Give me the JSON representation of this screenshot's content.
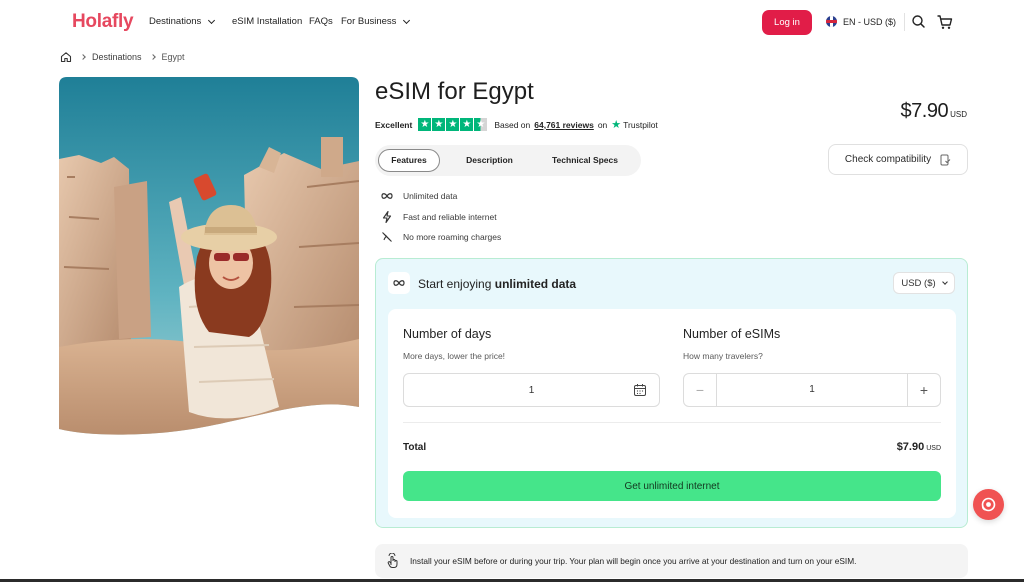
{
  "header": {
    "logo": "Holafly",
    "nav": [
      {
        "label": "Destinations",
        "has_dropdown": true
      },
      {
        "label": "eSIM Installation",
        "has_dropdown": false
      },
      {
        "label": "FAQs",
        "has_dropdown": false
      },
      {
        "label": "For Business",
        "has_dropdown": true
      }
    ],
    "login_label": "Log in",
    "language": "EN - USD ($)",
    "icons": [
      "globe-flag-icon",
      "search-icon",
      "cart-icon"
    ]
  },
  "breadcrumb": {
    "home_icon": "home-icon",
    "items": [
      "Destinations",
      "Egypt"
    ]
  },
  "product": {
    "title": "eSIM for Egypt",
    "price": "$7.90",
    "price_currency": "USD",
    "rating": {
      "label": "Excellent",
      "stars": 4.5,
      "based_on": "Based on",
      "reviews_link": "64,761 reviews",
      "on": "on",
      "provider": "Trustpilot"
    },
    "tabs": [
      "Features",
      "Description",
      "Technical Specs"
    ],
    "active_tab": "Features",
    "check_compat": "Check compatibility",
    "features": [
      {
        "icon": "infinity-icon",
        "label": "Unlimited data"
      },
      {
        "icon": "lightning-icon",
        "label": "Fast and reliable internet"
      },
      {
        "icon": "no-roaming-icon",
        "label": "No more roaming charges"
      }
    ]
  },
  "purchase": {
    "title_prefix": "Start enjoying",
    "title_bold": "unlimited data",
    "currency": "USD ($)",
    "days_label": "Number of days",
    "days_sub": "More days, lower the price!",
    "days_value": "1",
    "esims_label": "Number of eSIMs",
    "esims_sub": "How many travelers?",
    "esims_value": "1",
    "minus": "−",
    "plus": "+",
    "total_label": "Total",
    "total_value": "$7.90",
    "total_currency": "USD",
    "cta": "Get unlimited internet"
  },
  "notice": "Install your eSIM before or during your trip. Your plan will begin once you arrive at your destination and turn on your eSIM.",
  "colors": {
    "brand": "#e6485f",
    "login": "#e11d48",
    "cta": "#45e58a",
    "trustpilot": "#00b67a",
    "card_bg": "#e8f8fc",
    "card_border": "#b8ecd3"
  }
}
